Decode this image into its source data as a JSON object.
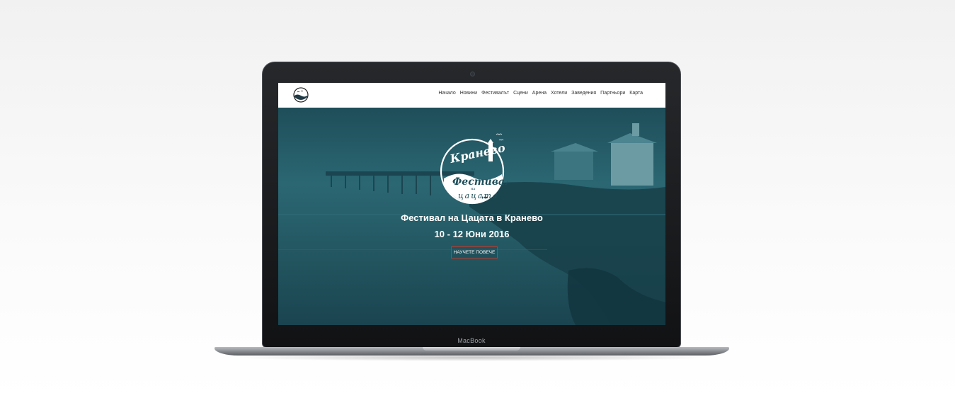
{
  "device": {
    "brand": "MacBook"
  },
  "site": {
    "nav": {
      "items": [
        "Начало",
        "Новини",
        "Фестивалът",
        "Сцени",
        "Арена",
        "Хотели",
        "Заведения",
        "Партньори",
        "Карта"
      ]
    },
    "logo": {
      "line1": "Краневo",
      "line2": "Фестивал",
      "line3": "на",
      "line4": "цацата"
    },
    "hero": {
      "title": "Фестивал на Цацата в Кранево",
      "date": "10 - 12 Юни 2016",
      "cta": "НАУЧЕТЕ ПОВЕЧЕ"
    }
  },
  "colors": {
    "hero_teal": "#21535f",
    "cta_border": "#c0392b",
    "navbar": "#ffffff"
  },
  "icons": [
    "logo-icon",
    "lighthouse-icon",
    "seagull-icon",
    "fish-icon"
  ]
}
